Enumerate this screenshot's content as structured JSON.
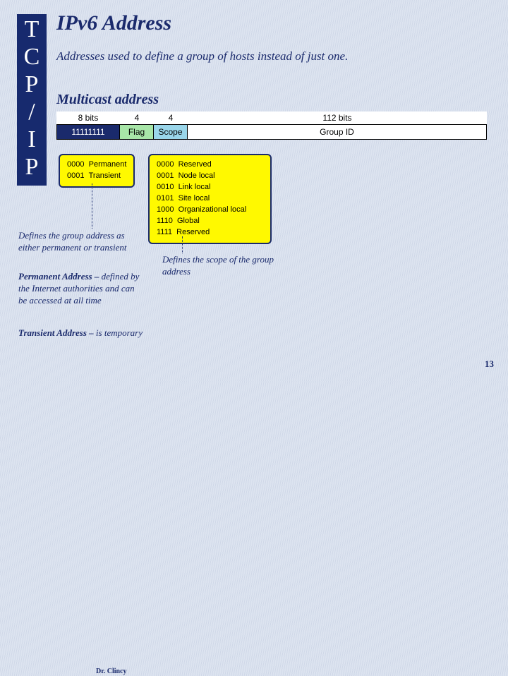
{
  "sidebar": {
    "letters": [
      "T",
      "C",
      "P",
      "/",
      "I",
      "P"
    ]
  },
  "title": "IPv6 Address",
  "intro": "Addresses used to define a group of hosts instead of just one.",
  "subhead": "Multicast address",
  "diagram": {
    "labels": {
      "a": "8 bits",
      "b": "4",
      "c": "4",
      "d": "112 bits"
    },
    "fields": {
      "a": "11111111",
      "b": "Flag",
      "c": "Scope",
      "d": "Group ID"
    }
  },
  "callouts": {
    "flag": [
      {
        "code": "0000",
        "text": "Permanent"
      },
      {
        "code": "0001",
        "text": "Transient"
      }
    ],
    "scope": [
      {
        "code": "0000",
        "text": "Reserved"
      },
      {
        "code": "0001",
        "text": "Node local"
      },
      {
        "code": "0010",
        "text": "Link local"
      },
      {
        "code": "0101",
        "text": "Site local"
      },
      {
        "code": "1000",
        "text": "Organizational local"
      },
      {
        "code": "1110",
        "text": "Global"
      },
      {
        "code": "1111",
        "text": "Reserved"
      }
    ]
  },
  "notes": {
    "group": "Defines the group address as either permanent or transient",
    "perm_label": "Permanent Address –",
    "perm_text": " defined by the Internet authorities and can be accessed at all time",
    "trans_label": "Transient Address –",
    "trans_text": " is temporary",
    "scope": "Defines the scope of the group address"
  },
  "author": "Dr. Clincy",
  "pagenum": "13"
}
